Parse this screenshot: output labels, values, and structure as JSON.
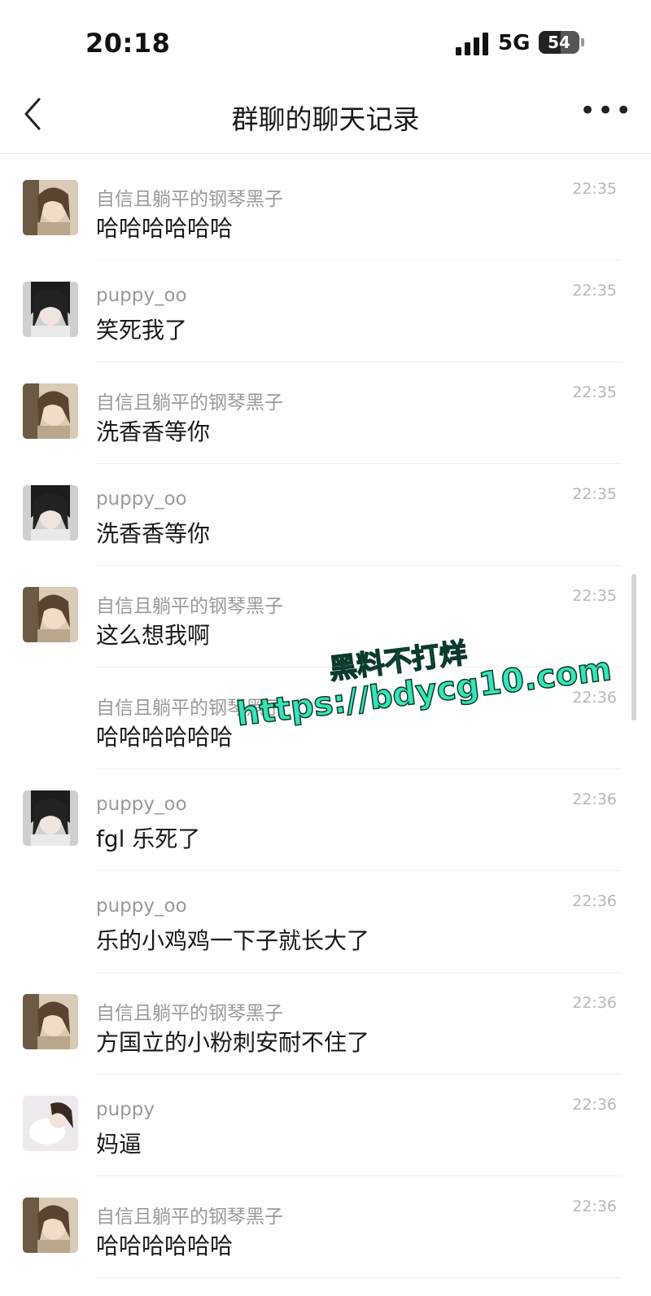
{
  "status_bar": {
    "time": "20:18",
    "network": "5G",
    "battery": "54",
    "battery_level": 0.54
  },
  "nav": {
    "title": "群聊的聊天记录",
    "back_icon": "chevron-left-icon",
    "more_icon": "more-icon",
    "more_glyph": "•••"
  },
  "messages": [
    {
      "sender": "自信且躺平的钢琴黑子",
      "text": "哈哈哈哈哈哈",
      "time": "22:35",
      "avatar": "avatar-girl-a"
    },
    {
      "sender": "puppy_oo",
      "text": "笑死我了",
      "time": "22:35",
      "avatar": "avatar-girl-b"
    },
    {
      "sender": "自信且躺平的钢琴黑子",
      "text": "洗香香等你",
      "time": "22:35",
      "avatar": "avatar-girl-a"
    },
    {
      "sender": "puppy_oo",
      "text": "洗香香等你",
      "time": "22:35",
      "avatar": "avatar-girl-b"
    },
    {
      "sender": "自信且躺平的钢琴黑子",
      "text": "这么想我啊",
      "time": "22:35",
      "avatar": "avatar-girl-a"
    },
    {
      "sender": "自信且躺平的钢琴黑子",
      "text": "哈哈哈哈哈哈",
      "time": "22:36",
      "avatar": ""
    },
    {
      "sender": "puppy_oo",
      "text": "fgl 乐死了",
      "time": "22:36",
      "avatar": "avatar-girl-b"
    },
    {
      "sender": "puppy_oo",
      "text": "乐的小鸡鸡一下子就长大了",
      "time": "22:36",
      "avatar": ""
    },
    {
      "sender": "自信且躺平的钢琴黑子",
      "text": "方国立的小粉刺安耐不住了",
      "time": "22:36",
      "avatar": "avatar-girl-a"
    },
    {
      "sender": "puppy",
      "text": "妈逼",
      "time": "22:36",
      "avatar": "avatar-girl-c"
    },
    {
      "sender": "自信且躺平的钢琴黑子",
      "text": "哈哈哈哈哈哈",
      "time": "22:36",
      "avatar": "avatar-girl-a"
    }
  ],
  "watermark": {
    "line1": "黑料不打烊",
    "line2": "https://bdycg10.com"
  }
}
